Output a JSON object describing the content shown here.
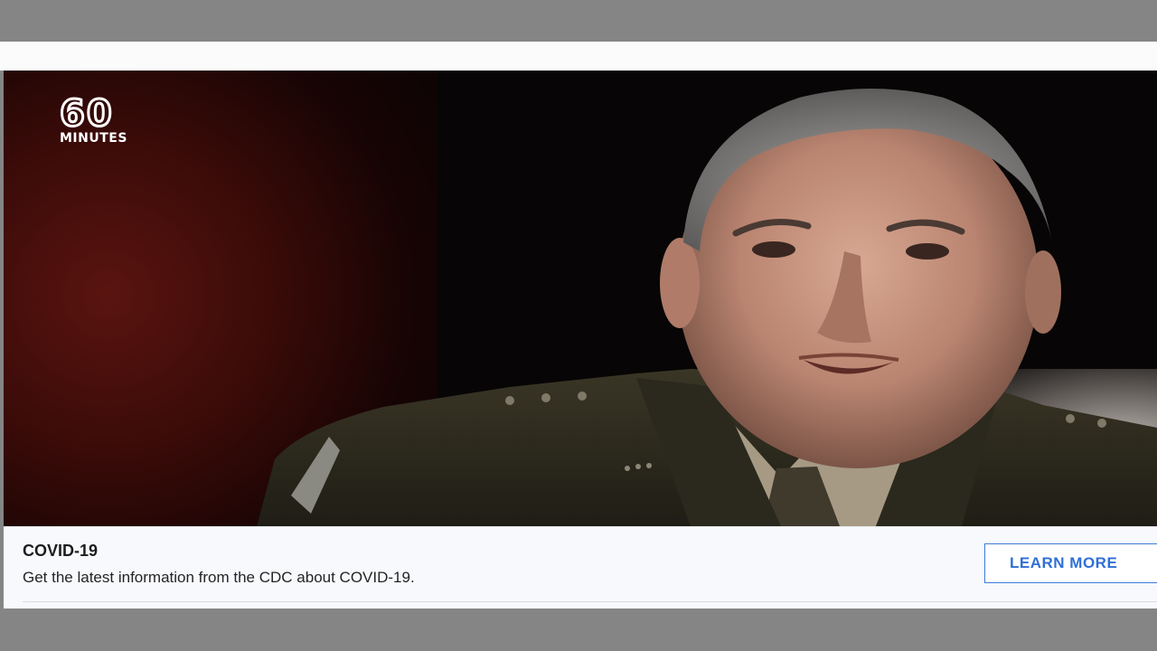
{
  "video": {
    "logo_number": "60",
    "logo_word": "MINUTES"
  },
  "info_panel": {
    "title": "COVID-19",
    "description": "Get the latest information from the CDC about COVID-19.",
    "button_label": "LEARN MORE"
  },
  "colors": {
    "background_gray": "#858585",
    "panel_background": "#f7f9fc",
    "button_accent": "#2f6fd6"
  }
}
